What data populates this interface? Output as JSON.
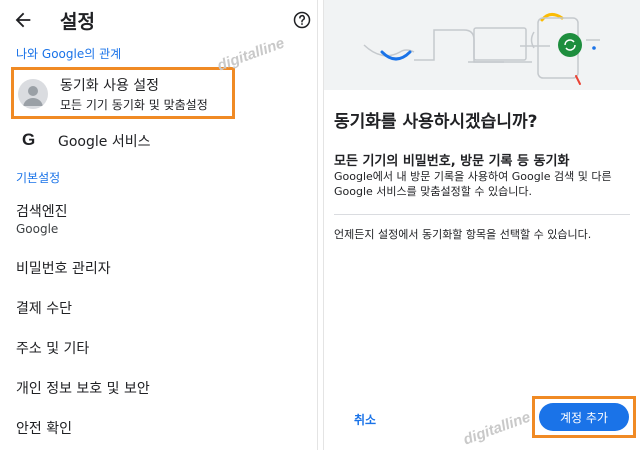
{
  "settings": {
    "title": "설정",
    "section_me_google": "나와 Google의 관계",
    "sync_title": "동기화 사용 설정",
    "sync_subtitle": "모든 기기 동기화 및 맞춤설정",
    "google_services": "Google 서비스",
    "section_basic": "기본설정",
    "search_engine_title": "검색엔진",
    "search_engine_value": "Google",
    "items": [
      "비밀번호 관리자",
      "결제 수단",
      "주소 및 기타",
      "개인 정보 보호 및 보안",
      "안전 확인"
    ]
  },
  "dialog": {
    "title": "동기화를 사용하시겠습니까?",
    "heading": "모든 기기의 비밀번호, 방문 기록 등 동기화",
    "body": "Google에서 내 방문 기록을 사용하여 Google 검색 및 다른 Google 서비스를 맞춤설정할 수 있습니다.",
    "note": "언제든지 설정에서 동기화할 항목을 선택할 수 있습니다.",
    "cancel_label": "취소",
    "add_account_label": "계정 추가"
  },
  "watermark": "digitalline",
  "colors": {
    "accent_blue": "#1a73e8",
    "highlight_orange": "#f08a24",
    "hero_bg": "#f1f3f4",
    "hero_green": "#1e8e3e",
    "hero_yellow": "#fbbc04"
  }
}
